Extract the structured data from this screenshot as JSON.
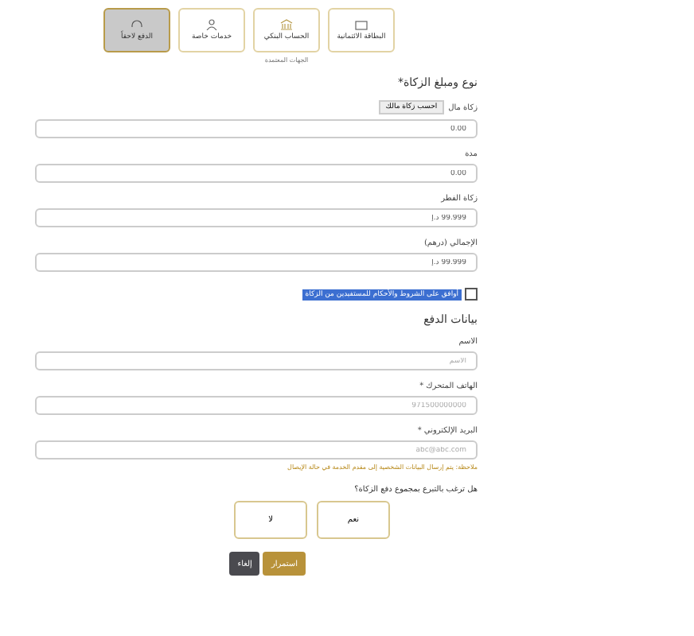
{
  "payment_methods": [
    {
      "label": "البطاقة الائتمانية",
      "selected": false
    },
    {
      "label": "الحساب البنكي",
      "selected": false,
      "caption": "الجهات المعتمدة"
    },
    {
      "label": "خدمات خاصة",
      "selected": false
    },
    {
      "label": "الدفع لاحقاً",
      "selected": true
    }
  ],
  "zakat_section": {
    "title": "نوع ومبلغ الزكاة*",
    "fields": [
      {
        "label": "زكاة مال",
        "calc_button": "احسب زكاة مالك",
        "value": "0.00"
      },
      {
        "label": "مدة",
        "value": "0.00"
      },
      {
        "label": "زكاة الفطر",
        "value": "99.999 د.إ"
      },
      {
        "label": "الإجمالي (درهم)",
        "value": "99.999 د.إ"
      }
    ],
    "agreement": {
      "text": "أوافق على الشروط والأحكام للمستفيدين من الزكاة",
      "checked": false
    }
  },
  "payment_section": {
    "title": "بيانات الدفع",
    "fields": [
      {
        "label": "الاسم",
        "placeholder": "الاسم"
      },
      {
        "label": "الهاتف المتحرك *",
        "placeholder": "971500000000"
      },
      {
        "label": "البريد الإلكتروني *",
        "placeholder": "abc@abc.com"
      }
    ],
    "note": "ملاحظة: يتم إرسال البيانات الشخصية إلى مقدم الخدمة في حالة الإيصال"
  },
  "donation_question": {
    "text": "هل ترغب بالتبرع بمجموع دفع الزكاة؟",
    "options": [
      {
        "label": "نعم",
        "selected": false
      },
      {
        "label": "لا",
        "selected": false
      }
    ]
  },
  "buttons": [
    {
      "label": "استمرار",
      "kind": "primary"
    },
    {
      "label": "إلغاء",
      "kind": "secondary"
    }
  ]
}
